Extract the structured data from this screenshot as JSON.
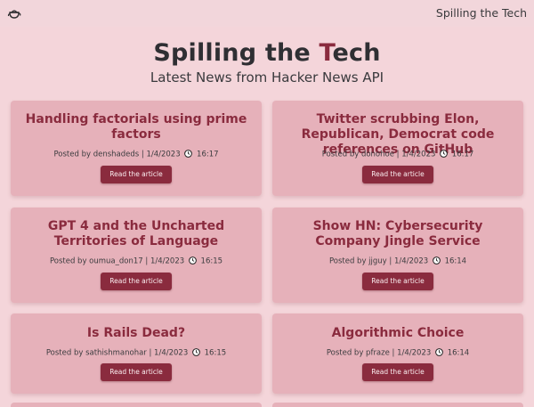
{
  "header": {
    "logo_icon": "teapot-icon",
    "brand": "Spilling the Tech"
  },
  "hero": {
    "title_part1": "Spilling the ",
    "title_accent": "T",
    "title_part2": "ech",
    "subtitle": "Latest News from Hacker News API"
  },
  "colors": {
    "background": "#f4d5da",
    "card": "#e6b1ba",
    "accent": "#8a2b3e"
  },
  "cards": [
    {
      "title": "Handling factorials using prime factors",
      "meta_prefix": "Posted by denshadeds | 1/4/2023",
      "time": "16:17",
      "button": "Read the article"
    },
    {
      "title": "Twitter scrubbing Elon, Republican, Democrat code references on GitHub",
      "meta_prefix": "Posted by donohoe | 1/4/2023",
      "time": "16:17",
      "button": "Read the article"
    },
    {
      "title": "GPT 4 and the Uncharted Territories of Language",
      "meta_prefix": "Posted by oumua_don17 | 1/4/2023",
      "time": "16:15",
      "button": "Read the article"
    },
    {
      "title": "Show HN: Cybersecurity Company Jingle Service",
      "meta_prefix": "Posted by jjguy | 1/4/2023",
      "time": "16:14",
      "button": "Read the article"
    },
    {
      "title": "Is Rails Dead?",
      "meta_prefix": "Posted by sathishmanohar | 1/4/2023",
      "time": "16:15",
      "button": "Read the article"
    },
    {
      "title": "Algorithmic Choice",
      "meta_prefix": "Posted by pfraze | 1/4/2023",
      "time": "16:14",
      "button": "Read the article"
    }
  ]
}
